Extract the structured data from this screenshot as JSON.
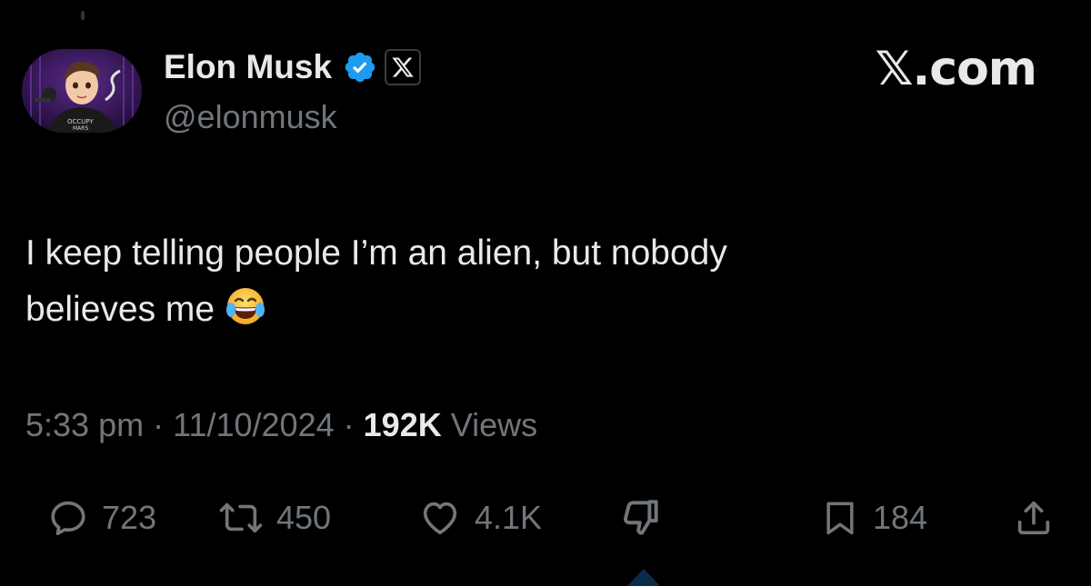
{
  "header": {
    "display_name": "Elon Musk",
    "handle": "@elonmusk",
    "site_label": "𝕏.com",
    "affiliate_badge_glyph": "𝕏"
  },
  "tweet": {
    "text_line1": "I keep telling people I’m an alien, but nobody",
    "text_line2": "believes me",
    "emoji": "face-with-tears-of-joy"
  },
  "meta": {
    "time": "5:33 pm",
    "separator": "·",
    "date": "11/10/2024",
    "views_count": "192K",
    "views_label": "Views"
  },
  "actions": {
    "replies": "723",
    "reposts": "450",
    "likes": "4.1K",
    "bookmarks": "184"
  },
  "colors": {
    "background": "#000000",
    "text_primary": "#e7e9ea",
    "text_secondary": "#71767b",
    "verified_blue": "#1d9bf0"
  }
}
